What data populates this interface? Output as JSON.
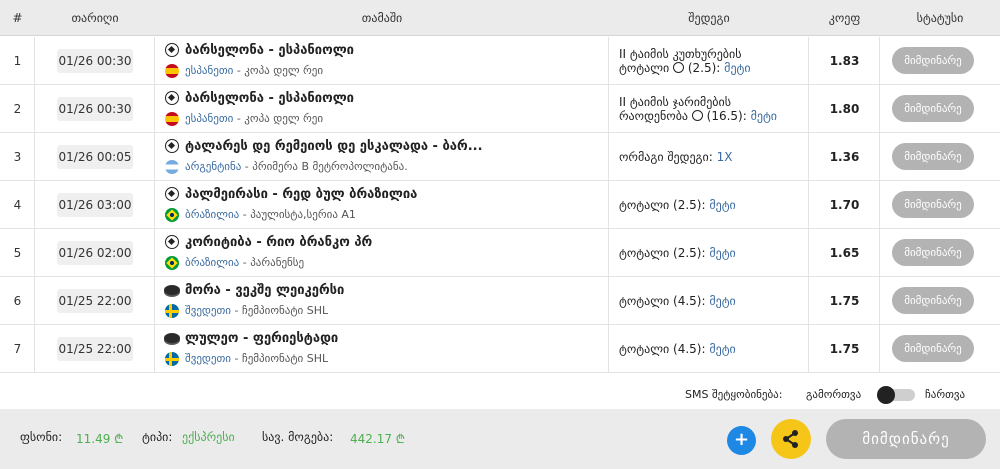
{
  "columns": {
    "num": "#",
    "date": "თარიღი",
    "game": "თამაში",
    "result": "შედეგი",
    "odds": "კოეფ",
    "status": "სტატუსი"
  },
  "rows": [
    {
      "num": "1",
      "date": "01/26 00:30",
      "sport_icon": "soccer-ball-icon",
      "flag": "spain-flag-icon",
      "title": "ბარსელონა - ესპანიოლი",
      "country": "ესპანეთი",
      "league": " - კოპა დელ რეი",
      "result_lines": [
        "II ტაიმის კუთხურების",
        "ტოტალი",
        " (2.5): ",
        "მეტი"
      ],
      "result_icon": "corner-ball-icon",
      "odds": "1.83",
      "status": "მიმდინარე"
    },
    {
      "num": "2",
      "date": "01/26 00:30",
      "sport_icon": "soccer-ball-icon",
      "flag": "spain-flag-icon",
      "title": "ბარსელონა - ესპანიოლი",
      "country": "ესპანეთი",
      "league": " - კოპა დელ რეი",
      "result_lines": [
        "II ტაიმის ჯარიმების",
        "რაოდენობა",
        " (16.5): ",
        "მეტი"
      ],
      "result_icon": "card-icon",
      "odds": "1.80",
      "status": "მიმდინარე"
    },
    {
      "num": "3",
      "date": "01/26 00:05",
      "sport_icon": "soccer-ball-icon",
      "flag": "argentina-flag-icon",
      "title": "ტალარეს დე რემეიოს დე ესკალადა - ბარ...",
      "country": "არგენტინა",
      "league": " - პრიმერა B მეტროპოლიტანა.",
      "result_text": "ორმაგი შედეგი: ",
      "result_value": "1X",
      "odds": "1.36",
      "status": "მიმდინარე"
    },
    {
      "num": "4",
      "date": "01/26 03:00",
      "sport_icon": "soccer-ball-icon",
      "flag": "brazil-flag-icon",
      "title": "პალმეირასი - რედ ბულ ბრაზილია",
      "country": "ბრაზილია",
      "league": " - პაულისტა,სერია A1",
      "result_text": "ტოტალი (2.5): ",
      "result_value": "მეტი",
      "odds": "1.70",
      "status": "მიმდინარე"
    },
    {
      "num": "5",
      "date": "01/26 02:00",
      "sport_icon": "soccer-ball-icon",
      "flag": "brazil-flag-icon",
      "title": "კორიტიბა - რიო ბრანკო პრ",
      "country": "ბრაზილია",
      "league": " - პარანენსე",
      "result_text": "ტოტალი (2.5): ",
      "result_value": "მეტი",
      "odds": "1.65",
      "status": "მიმდინარე"
    },
    {
      "num": "6",
      "date": "01/25 22:00",
      "sport_icon": "hockey-puck-icon",
      "flag": "sweden-flag-icon",
      "title": "მორა - ვეკშე ლეიკერსი",
      "country": "შვედეთი",
      "league": " - ჩემპიონატი SHL",
      "result_text": "ტოტალი (4.5): ",
      "result_value": "მეტი",
      "odds": "1.75",
      "status": "მიმდინარე"
    },
    {
      "num": "7",
      "date": "01/25 22:00",
      "sport_icon": "hockey-puck-icon",
      "flag": "sweden-flag-icon",
      "title": "ლულეო - ფერიესტადი",
      "country": "შვედეთი",
      "league": " - ჩემპიონატი SHL",
      "result_text": "ტოტალი (4.5): ",
      "result_value": "მეტი",
      "odds": "1.75",
      "status": "მიმდინარე"
    }
  ],
  "sms": {
    "label": "SMS შეტყობინება:",
    "off": "გამორთვა",
    "on": "ჩართვა",
    "enabled": false
  },
  "footer": {
    "stake_label": "ფსონი:",
    "stake_value": "11.49 ₾",
    "type_label": "ტიპი:",
    "type_value": "ექსპრესი",
    "potential_label": "სავ. მოგება:",
    "potential_value": "442.17 ₾",
    "add_icon": "+",
    "big_button": "მიმდინარე"
  },
  "colors": {
    "header_bg": "#ebebeb",
    "status_gray": "#b3b3b3",
    "link_blue": "#3b6aa0",
    "money_green": "#4caf50",
    "plus_blue": "#1e88e5",
    "share_yellow": "#f5c518"
  }
}
